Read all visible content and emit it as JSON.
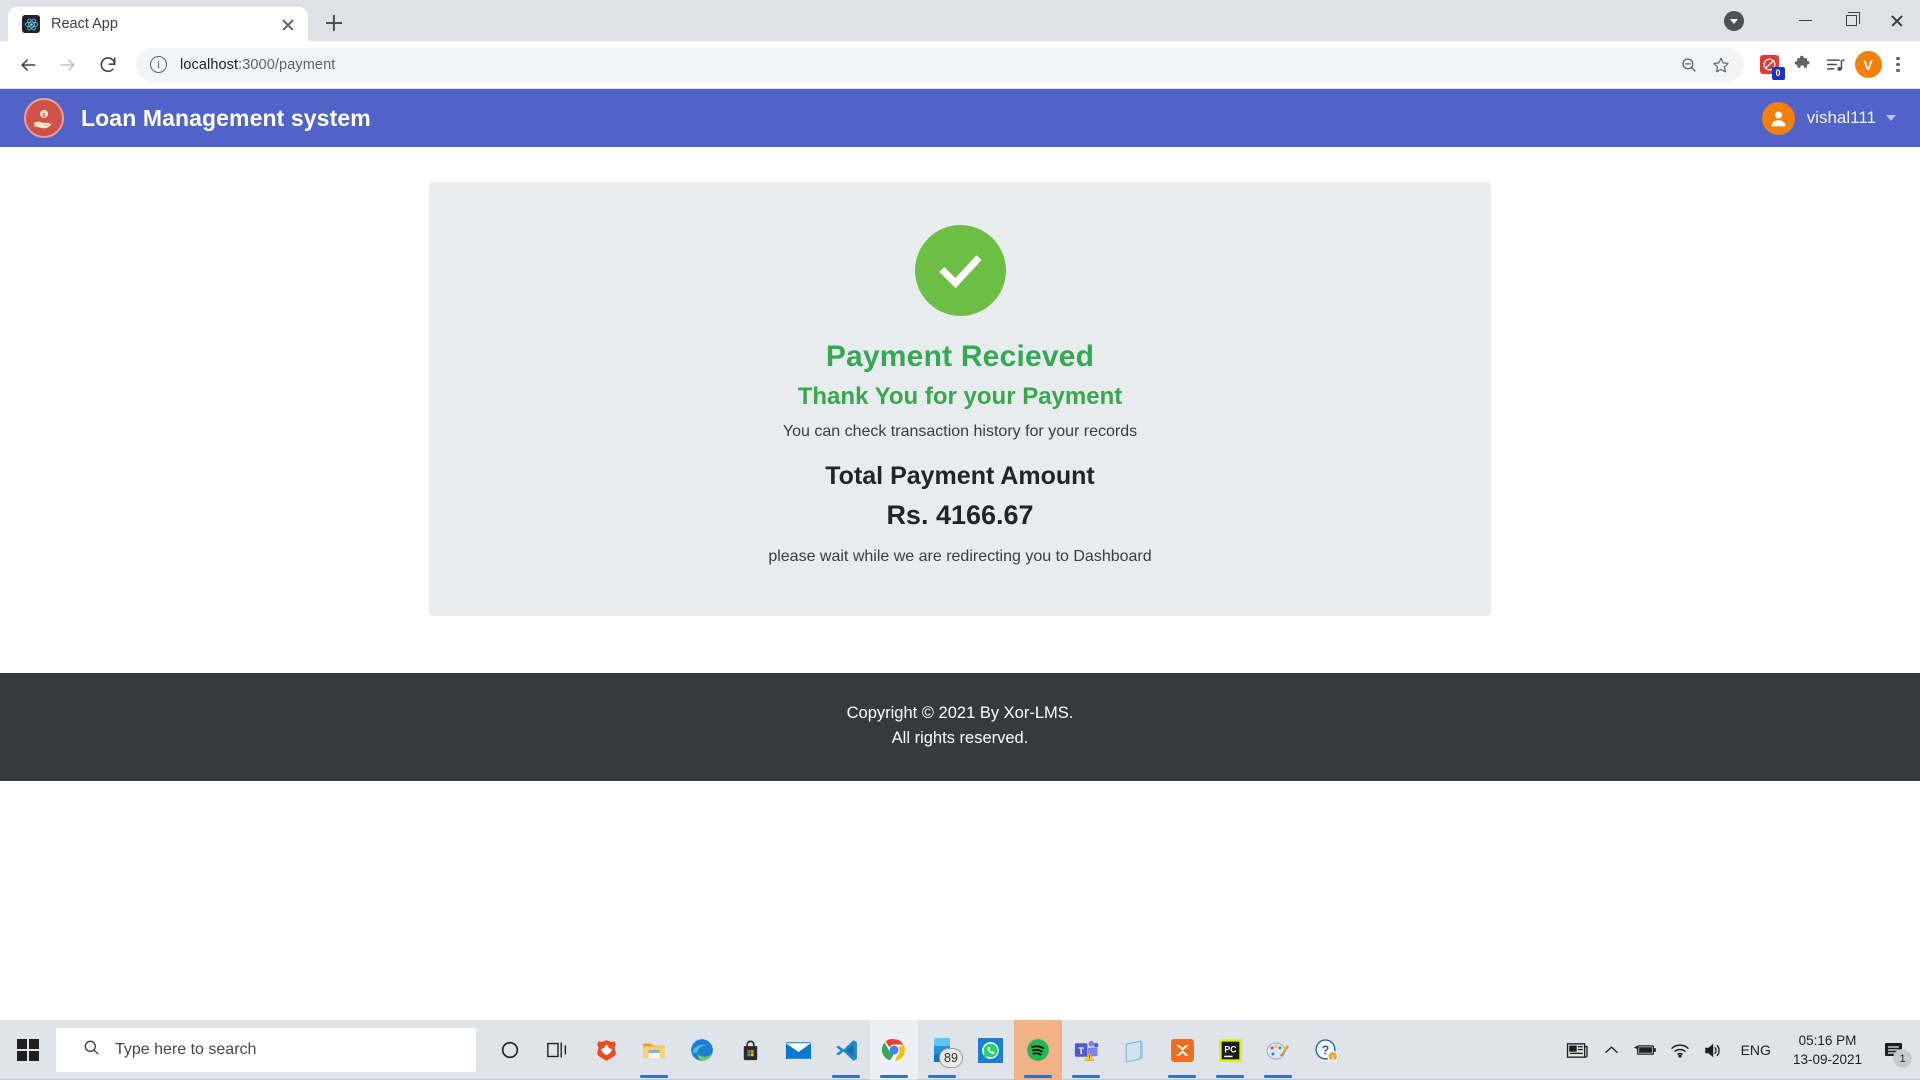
{
  "browser": {
    "tab": {
      "title": "React App",
      "favicon": "react-icon",
      "close": "close-icon"
    },
    "new_tab": "new-tab-button",
    "window_controls": {
      "tab_search": "tab-search-icon",
      "minimize": "minimize",
      "maximize": "restore",
      "close": "close"
    },
    "nav": {
      "back": "back-arrow",
      "forward": "forward-arrow",
      "reload": "reload-icon"
    },
    "omnibox": {
      "site_info": "info-icon",
      "url_host": "localhost",
      "url_path": ":3000/payment",
      "zoom_icon": "zoom-out-icon",
      "bookmark_icon": "star-icon"
    },
    "extensions": {
      "adblock_badge": "0",
      "puzzle": "extensions-icon",
      "media": "media-playlist-icon"
    },
    "profile_initial": "V",
    "menu": "three-dot-menu"
  },
  "app": {
    "navbar": {
      "brand_title": "Loan Management system",
      "logo": "money-hand-logo",
      "user_name": "vishal111",
      "user_avatar": "user-avatar-icon",
      "caret": "chevron-down-icon"
    },
    "card": {
      "success_icon": "check-circle-icon",
      "heading": "Payment Recieved",
      "subheading": "Thank You for your Payment",
      "note": "You can check transaction history for your records",
      "amount_label": "Total Payment Amount",
      "amount_value": "Rs. 4166.67",
      "redirect_note": "please wait while we are redirecting you to Dashboard"
    },
    "footer": {
      "line1": "Copyright © 2021 By Xor-LMS.",
      "line2": "All rights reserved."
    }
  },
  "colors": {
    "navbar": "#5163c9",
    "success_green": "#6dbe45",
    "heading_green": "#34a853",
    "card_bg": "#e8ecef",
    "footer_bg": "#343a40",
    "avatar_orange": "#f2800a"
  },
  "taskbar": {
    "start": "windows-start-icon",
    "search_placeholder": "Type here to search",
    "search_icon": "search-icon",
    "apps": [
      {
        "name": "cortana",
        "label": "Cortana"
      },
      {
        "name": "task-view",
        "label": "Task View"
      },
      {
        "name": "brave",
        "label": "Brave"
      },
      {
        "name": "file-explorer",
        "label": "File Explorer"
      },
      {
        "name": "microsoft-edge",
        "label": "Microsoft Edge"
      },
      {
        "name": "microsoft-store",
        "label": "Microsoft Store"
      },
      {
        "name": "mail",
        "label": "Mail"
      },
      {
        "name": "visual-studio-code",
        "label": "Visual Studio Code"
      },
      {
        "name": "google-chrome",
        "label": "Google Chrome"
      },
      {
        "name": "your-phone",
        "label": "Your Phone",
        "badge": "89"
      },
      {
        "name": "whatsapp",
        "label": "WhatsApp"
      },
      {
        "name": "spotify",
        "label": "Spotify"
      },
      {
        "name": "microsoft-teams",
        "label": "Microsoft Teams"
      },
      {
        "name": "notepad",
        "label": "Notepad"
      },
      {
        "name": "xampp",
        "label": "XAMPP"
      },
      {
        "name": "pycharm",
        "label": "PyCharm"
      },
      {
        "name": "paint",
        "label": "Paint"
      },
      {
        "name": "help",
        "label": "Get Help"
      }
    ],
    "tray": {
      "news": "news-weather-icon",
      "overflow": "show-hidden-icons-chevron",
      "battery": "battery-charging-icon",
      "wifi": "wifi-icon",
      "volume": "volume-icon",
      "language": "ENG",
      "time": "05:16 PM",
      "date": "13-09-2021",
      "notifications": "action-center-icon",
      "notification_count": "1"
    }
  }
}
